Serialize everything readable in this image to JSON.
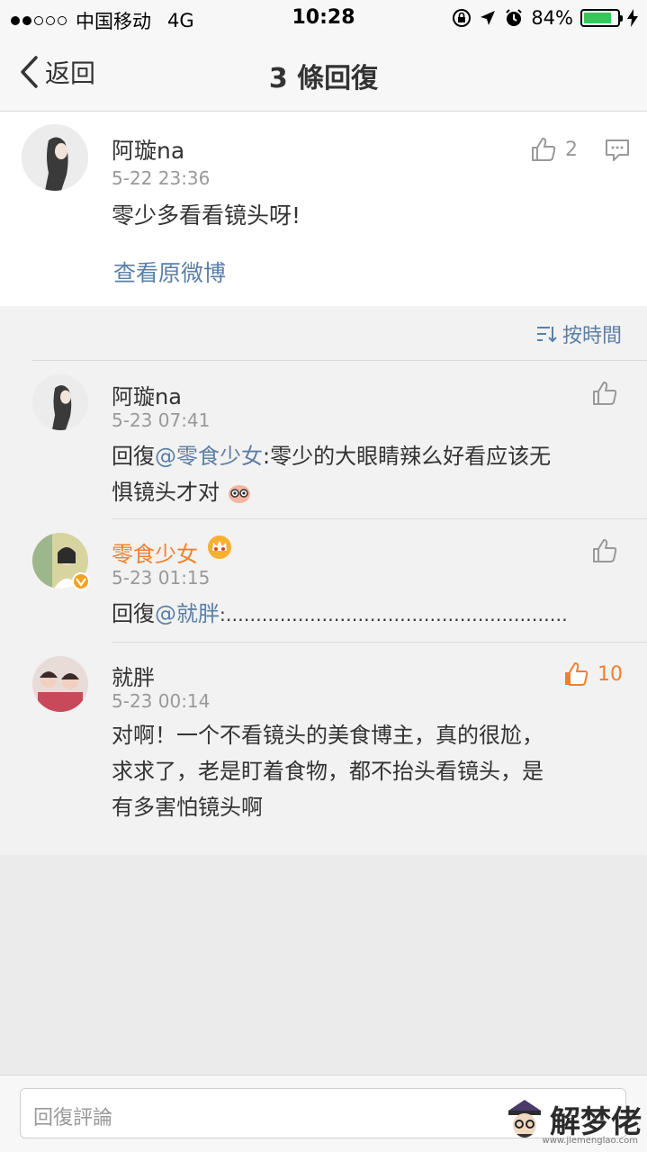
{
  "status_bar": {
    "carrier": "中国移动",
    "network": "4G",
    "time": "10:28",
    "battery_percent": "84%",
    "battery_level": 0.84,
    "signal_bars_filled": 2,
    "signal_bars_total": 5
  },
  "nav": {
    "back_label": "返回",
    "title": "3 條回復"
  },
  "main_comment": {
    "author": "阿璇na",
    "time": "5-22 23:36",
    "text": "零少多看看镜头呀!",
    "like_count": "2",
    "view_original_label": "查看原微博"
  },
  "sort": {
    "label": "按時間"
  },
  "replies": [
    {
      "author": "阿璇na",
      "time": "5-23 07:41",
      "prefix": "回復",
      "mention": "@零食少女",
      "text_line1": ":零少的大眼睛辣么好看应该无",
      "text_line2": "惧镜头才对",
      "like_count": ""
    },
    {
      "author": "零食少女",
      "time": "5-23 01:15",
      "prefix": "回復",
      "mention": "@就胖",
      "text_line1": ":…………………………………………………",
      "like_count": ""
    },
    {
      "author": "就胖",
      "time": "5-23 00:14",
      "text_line1": "对啊！一个不看镜头的美食博主，真的很尬，",
      "text_line2": "求求了，老是盯着食物，都不抬头看镜头，是",
      "text_line3": "有多害怕镜头啊",
      "like_count": "10"
    }
  ],
  "input": {
    "placeholder": "回復評論"
  },
  "watermark": {
    "text": "解梦佬",
    "url": "www.jiemenglao.com"
  },
  "colors": {
    "link": "#5b7fa6",
    "vip_name": "#f08030",
    "hot_like": "#f08030",
    "battery": "#35c759"
  }
}
